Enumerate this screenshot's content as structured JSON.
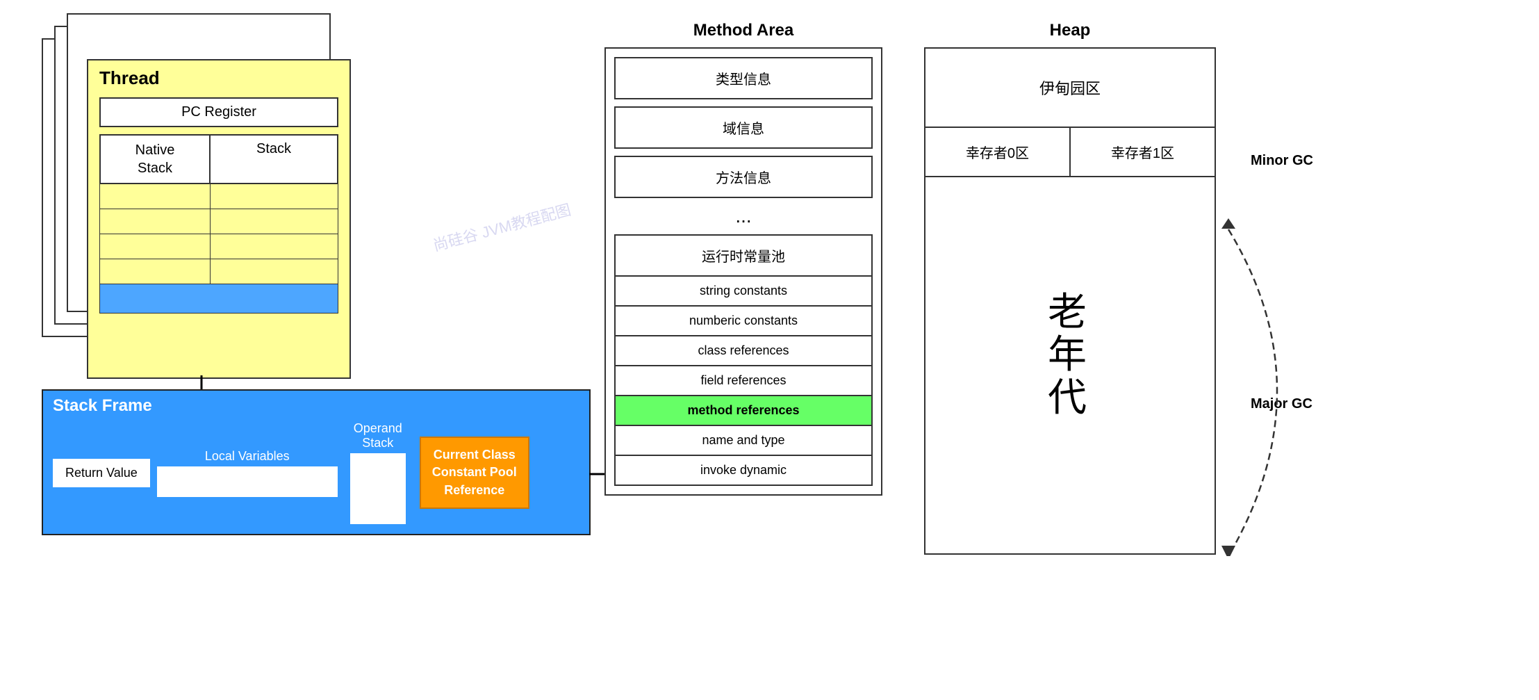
{
  "thread": {
    "label": "Thread",
    "pc_register": "PC Register",
    "native_stack": "Native\nStack",
    "stack": "Stack"
  },
  "stack_frame": {
    "label": "Stack Frame",
    "return_value": "Return Value",
    "local_variables": "Local Variables",
    "operand_stack_label": "Operand\nStack",
    "current_class": "Current Class\nConstant Pool\nReference"
  },
  "method_area": {
    "title": "Method Area",
    "items": [
      "类型信息",
      "域信息",
      "方法信息"
    ],
    "dots": "...",
    "runtime_pool": "运行时常量池",
    "pool_items": [
      {
        "label": "string constants",
        "highlighted": false
      },
      {
        "label": "numberic constants",
        "highlighted": false
      },
      {
        "label": "class references",
        "highlighted": false
      },
      {
        "label": "field references",
        "highlighted": false
      },
      {
        "label": "method references",
        "highlighted": true
      },
      {
        "label": "name and type",
        "highlighted": false
      },
      {
        "label": "invoke dynamic",
        "highlighted": false
      }
    ]
  },
  "heap": {
    "title": "Heap",
    "eden": "伊甸园区",
    "survivor0": "幸存者0区",
    "survivor1": "幸存者1区",
    "old_gen": "老\n年\n代",
    "minor_gc": "Minor\nGC",
    "major_gc": "Major\nGC"
  },
  "watermark": "尚硅谷 JVM教程配图"
}
